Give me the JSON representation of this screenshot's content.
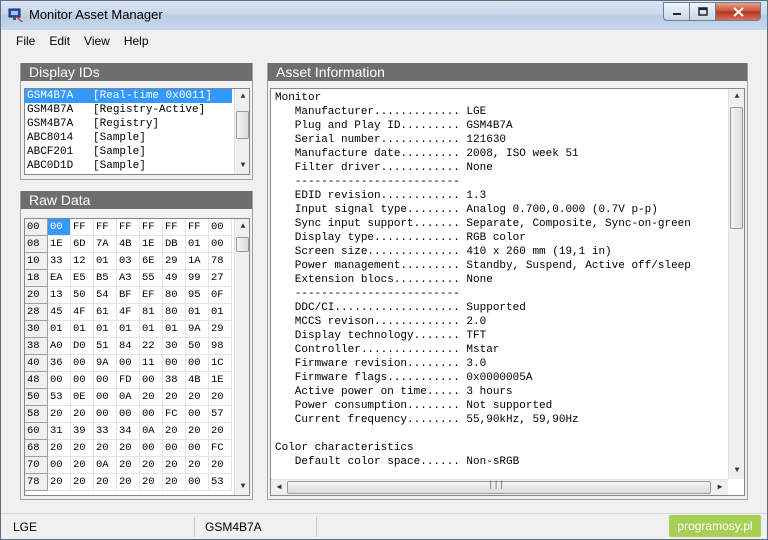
{
  "window": {
    "title": "Monitor Asset Manager",
    "min": "0",
    "max": "1",
    "close": "r"
  },
  "menu": [
    "File",
    "Edit",
    "View",
    "Help"
  ],
  "display_ids": {
    "title": "Display IDs",
    "items": [
      "GSM4B7A   [Real-time 0x0011]",
      "GSM4B7A   [Registry-Active]",
      "GSM4B7A   [Registry]",
      "ABC8014   [Sample]",
      "ABCF201   [Sample]",
      "ABC0D1D   [Sample]"
    ],
    "selected_index": 0
  },
  "raw_data": {
    "title": "Raw Data",
    "columns": [
      "00",
      "00",
      "FF",
      "FF",
      "FF",
      "FF",
      "FF",
      "FF",
      "00"
    ],
    "rows": [
      [
        "08",
        "1E",
        "6D",
        "7A",
        "4B",
        "1E",
        "DB",
        "01",
        "00"
      ],
      [
        "10",
        "33",
        "12",
        "01",
        "03",
        "6E",
        "29",
        "1A",
        "78"
      ],
      [
        "18",
        "EA",
        "E5",
        "B5",
        "A3",
        "55",
        "49",
        "99",
        "27"
      ],
      [
        "20",
        "13",
        "50",
        "54",
        "BF",
        "EF",
        "80",
        "95",
        "0F"
      ],
      [
        "28",
        "45",
        "4F",
        "61",
        "4F",
        "81",
        "80",
        "01",
        "01"
      ],
      [
        "30",
        "01",
        "01",
        "01",
        "01",
        "01",
        "01",
        "9A",
        "29"
      ],
      [
        "38",
        "A0",
        "D0",
        "51",
        "84",
        "22",
        "30",
        "50",
        "98"
      ],
      [
        "40",
        "36",
        "00",
        "9A",
        "00",
        "11",
        "00",
        "00",
        "1C"
      ],
      [
        "48",
        "00",
        "00",
        "00",
        "FD",
        "00",
        "38",
        "4B",
        "1E"
      ],
      [
        "50",
        "53",
        "0E",
        "00",
        "0A",
        "20",
        "20",
        "20",
        "20"
      ],
      [
        "58",
        "20",
        "20",
        "00",
        "00",
        "00",
        "FC",
        "00",
        "57"
      ],
      [
        "60",
        "31",
        "39",
        "33",
        "34",
        "0A",
        "20",
        "20",
        "20"
      ],
      [
        "68",
        "20",
        "20",
        "20",
        "20",
        "00",
        "00",
        "00",
        "FC"
      ],
      [
        "70",
        "00",
        "20",
        "0A",
        "20",
        "20",
        "20",
        "20",
        "20"
      ],
      [
        "78",
        "20",
        "20",
        "20",
        "20",
        "20",
        "20",
        "00",
        "53"
      ]
    ]
  },
  "asset_info": {
    "title": "Asset Information",
    "lines": [
      "Monitor",
      "   Manufacturer............. LGE",
      "   Plug and Play ID......... GSM4B7A",
      "   Serial number............ 121630",
      "   Manufacture date......... 2008, ISO week 51",
      "   Filter driver............ None",
      "   -------------------------",
      "   EDID revision............ 1.3",
      "   Input signal type........ Analog 0.700,0.000 (0.7V p-p)",
      "   Sync input support....... Separate, Composite, Sync-on-green",
      "   Display type............. RGB color",
      "   Screen size.............. 410 x 260 mm (19,1 in)",
      "   Power management......... Standby, Suspend, Active off/sleep",
      "   Extension blocs.......... None",
      "   -------------------------",
      "   DDC/CI................... Supported",
      "   MCCS revison............. 2.0",
      "   Display technology....... TFT",
      "   Controller............... Mstar",
      "   Firmware revision........ 3.0",
      "   Firmware flags........... 0x0000005A",
      "   Active power on time..... 3 hours",
      "   Power consumption........ Not supported",
      "   Current frequency........ 55,90kHz, 59,90Hz",
      "",
      "Color characteristics",
      "   Default color space...... Non-sRGB"
    ]
  },
  "status": {
    "left": "LGE",
    "middle": "GSM4B7A",
    "watermark": "programosy.pl"
  },
  "colors": {
    "selection": "#3399ff",
    "panel_header": "#6e6e6e",
    "watermark_bg": "#a6cf54"
  },
  "icons": {
    "app": "monitor-app-icon",
    "scroll_up": "arrow-up-icon",
    "scroll_down": "arrow-down-icon",
    "scroll_left": "arrow-left-icon",
    "scroll_right": "arrow-right-icon",
    "grip": "thumb-grip-icon"
  }
}
